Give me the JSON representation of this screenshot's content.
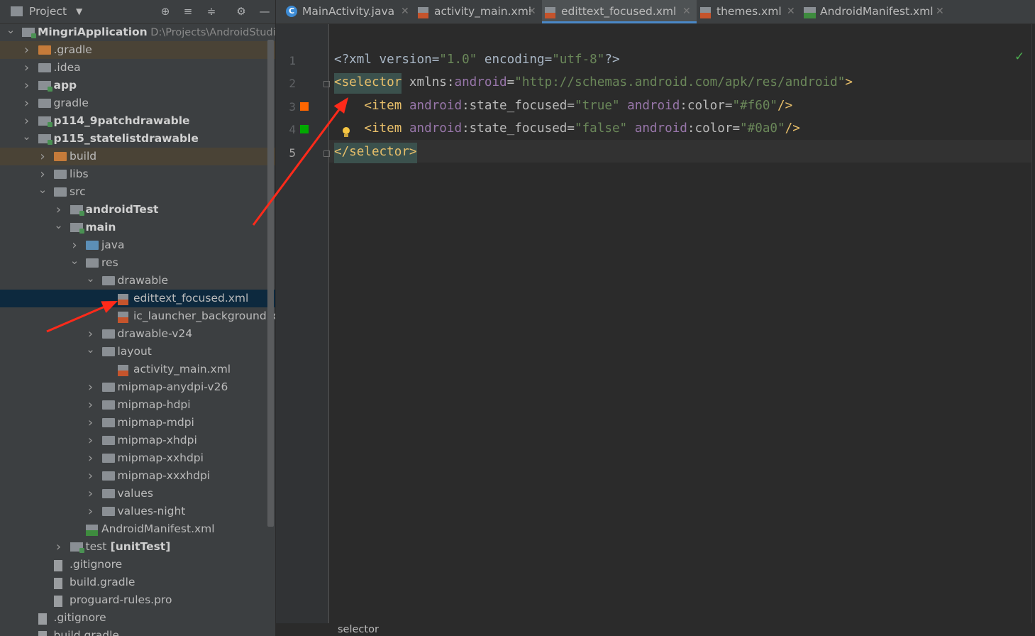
{
  "project_panel": {
    "title": "Project",
    "tree": [
      {
        "label": "MingriApplication",
        "path": "D:\\Projects\\AndroidStudio",
        "bold": true,
        "expanded": true
      },
      {
        "label": ".gradle"
      },
      {
        "label": ".idea"
      },
      {
        "label": "app",
        "bold": true
      },
      {
        "label": "gradle"
      },
      {
        "label": "p114_9patchdrawable",
        "bold": true
      },
      {
        "label": "p115_statelistdrawable",
        "bold": true,
        "expanded": true
      },
      {
        "label": "build"
      },
      {
        "label": "libs"
      },
      {
        "label": "src",
        "expanded": true
      },
      {
        "label": "androidTest",
        "bold": true
      },
      {
        "label": "main",
        "bold": true,
        "expanded": true
      },
      {
        "label": "java"
      },
      {
        "label": "res",
        "expanded": true
      },
      {
        "label": "drawable",
        "expanded": true
      },
      {
        "label": "edittext_focused.xml",
        "selected": true
      },
      {
        "label": "ic_launcher_background.xml"
      },
      {
        "label": "drawable-v24"
      },
      {
        "label": "layout",
        "expanded": true
      },
      {
        "label": "activity_main.xml"
      },
      {
        "label": "mipmap-anydpi-v26"
      },
      {
        "label": "mipmap-hdpi"
      },
      {
        "label": "mipmap-mdpi"
      },
      {
        "label": "mipmap-xhdpi"
      },
      {
        "label": "mipmap-xxhdpi"
      },
      {
        "label": "mipmap-xxxhdpi"
      },
      {
        "label": "values"
      },
      {
        "label": "values-night"
      },
      {
        "label": "AndroidManifest.xml"
      },
      {
        "label": "test",
        "suffix": "[unitTest]"
      },
      {
        "label": ".gitignore"
      },
      {
        "label": "build.gradle"
      },
      {
        "label": "proguard-rules.pro"
      },
      {
        "label": ".gitignore"
      },
      {
        "label": "build.gradle"
      }
    ]
  },
  "tabs": [
    {
      "label": "MainActivity.java",
      "icon": "java-class-icon"
    },
    {
      "label": "activity_main.xml",
      "icon": "xml-file-icon"
    },
    {
      "label": "edittext_focused.xml",
      "icon": "xml-file-icon",
      "active": true
    },
    {
      "label": "themes.xml",
      "icon": "xml-file-icon"
    },
    {
      "label": "AndroidManifest.xml",
      "icon": "manifest-file-icon"
    }
  ],
  "editor": {
    "line_numbers": [
      "1",
      "2",
      "3",
      "4",
      "5"
    ],
    "lines": [
      {
        "parts": [
          [
            "plain",
            "<?xml version="
          ],
          [
            "str",
            "\"1.0\""
          ],
          [
            "plain",
            " encoding="
          ],
          [
            "str",
            "\"utf-8\""
          ],
          [
            "plain",
            "?>"
          ]
        ]
      },
      {
        "parts": [
          [
            "tagbg",
            "<selector"
          ],
          [
            "attr",
            " xmlns:"
          ],
          [
            "ns",
            "android"
          ],
          [
            "attr",
            "="
          ],
          [
            "str",
            "\"http://schemas.android.com/apk/res/android\""
          ],
          [
            "tag",
            ">"
          ]
        ]
      },
      {
        "parts": [
          [
            "tag",
            "    <item "
          ],
          [
            "ns",
            "android"
          ],
          [
            "attr",
            ":state_focused="
          ],
          [
            "str",
            "\"true\""
          ],
          [
            "attr",
            " "
          ],
          [
            "ns",
            "android"
          ],
          [
            "attr",
            ":color="
          ],
          [
            "str",
            "\"#f60\""
          ],
          [
            "tag",
            "/>"
          ]
        ]
      },
      {
        "parts": [
          [
            "tag",
            "    <item "
          ],
          [
            "ns",
            "android"
          ],
          [
            "attr",
            ":state_focused="
          ],
          [
            "str",
            "\"false\""
          ],
          [
            "attr",
            " "
          ],
          [
            "ns",
            "android"
          ],
          [
            "attr",
            ":color="
          ],
          [
            "str",
            "\"#0a0\""
          ],
          [
            "tag",
            "/>"
          ]
        ]
      },
      {
        "parts": [
          [
            "tagbg",
            "</selector>"
          ]
        ]
      }
    ],
    "gutter_swatches": [
      "#ff6600",
      "#00aa00"
    ],
    "breadcrumb": "selector",
    "status_ok": "✓"
  },
  "annotations": {
    "arrow_color": "#ff2a1a"
  }
}
